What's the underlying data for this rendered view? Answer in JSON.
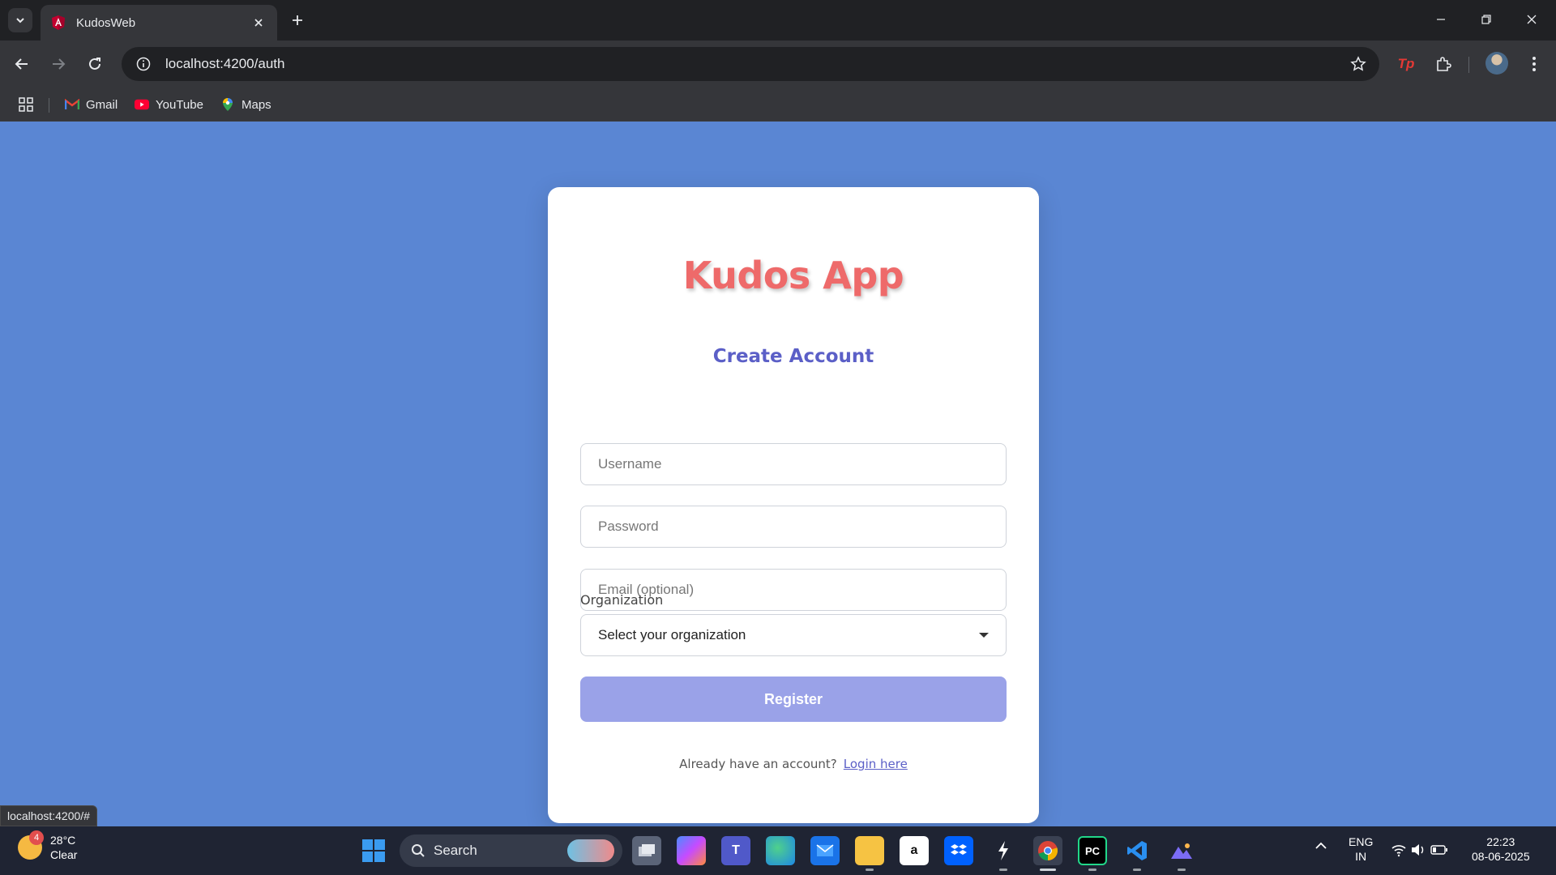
{
  "browser": {
    "tab_title": "KudosWeb",
    "url": "localhost:4200/auth",
    "bookmarks": [
      {
        "label": "Gmail",
        "icon": "gmail-icon"
      },
      {
        "label": "YouTube",
        "icon": "youtube-icon"
      },
      {
        "label": "Maps",
        "icon": "maps-icon"
      }
    ],
    "extension_badge": "Tp",
    "status_url": "localhost:4200/#"
  },
  "page": {
    "app_title": "Kudos App",
    "form_title": "Create Account",
    "username_placeholder": "Username",
    "password_placeholder": "Password",
    "email_placeholder": "Email (optional)",
    "organization_label": "Organization",
    "organization_selected": "Select your organization",
    "register_label": "Register",
    "footer_text": "Already have an account?",
    "login_link": "Login here",
    "colors": {
      "background": "#5a86d3",
      "title": "#ee6a6a",
      "accent": "#5b5fc7",
      "button": "#9aa2e8"
    }
  },
  "taskbar": {
    "weather_temp": "28°C",
    "weather_desc": "Clear",
    "weather_badge": "4",
    "search_label": "Search",
    "language": "ENG",
    "region": "IN",
    "time": "22:23",
    "date": "08-06-2025"
  }
}
